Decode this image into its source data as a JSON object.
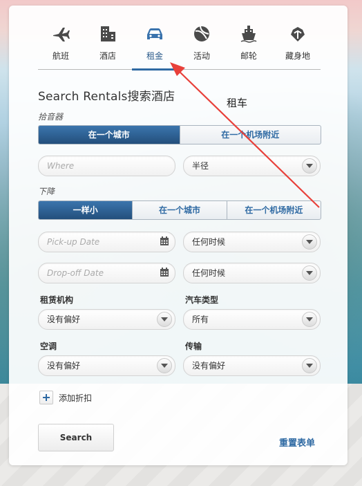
{
  "tabs": [
    {
      "label": "航班",
      "icon": "plane-icon"
    },
    {
      "label": "酒店",
      "icon": "hotel-icon"
    },
    {
      "label": "租金",
      "icon": "car-icon",
      "active": true
    },
    {
      "label": "活动",
      "icon": "beach-ball-icon"
    },
    {
      "label": "邮轮",
      "icon": "cruise-ship-icon"
    },
    {
      "label": "藏身地",
      "icon": "getaway-icon"
    }
  ],
  "form": {
    "title": "Search Rentals搜索酒店",
    "annotation": "租车",
    "pickup_label": "拾音器",
    "pickup_options": [
      "在一个城市",
      "在一个机场附近"
    ],
    "where_placeholder": "Where",
    "radius_value": "半径",
    "dropoff_label": "下降",
    "dropoff_options": [
      "一样小",
      "在一个城市",
      "在一个机场附近"
    ],
    "pickup_date_placeholder": "Pick-up Date",
    "pickup_time": "任何时候",
    "dropoff_date_placeholder": "Drop-off Date",
    "dropoff_time": "任何时候",
    "agency_label": "租赁机构",
    "agency_value": "没有偏好",
    "car_type_label": "汽车类型",
    "car_type_value": "所有",
    "ac_label": "空调",
    "ac_value": "没有偏好",
    "transmission_label": "传输",
    "transmission_value": "没有偏好",
    "add_discount": "添加折扣",
    "search_button": "Search",
    "reset_link": "重置表单"
  },
  "colors": {
    "accent": "#2f6aa3",
    "segment_active": "#234f7c",
    "annotation_arrow": "#e8403a"
  }
}
